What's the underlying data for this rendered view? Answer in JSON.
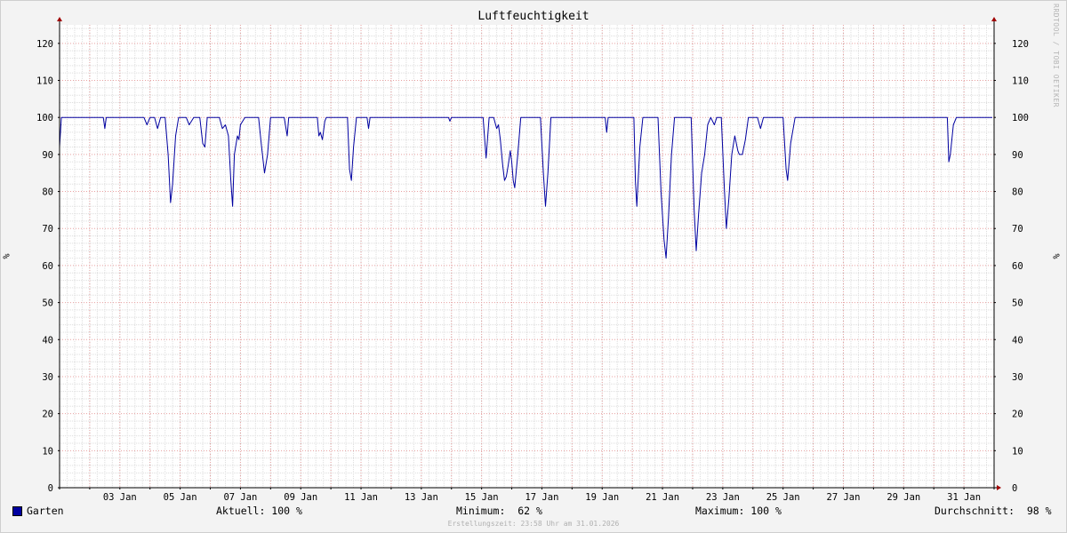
{
  "window": {
    "title": "Luftfeuchtigkeit",
    "credit": "RRDTOOL / TOBI OETIKER",
    "footer": "Erstellungszeit: 23:58 Uhr am 31.01.2026"
  },
  "colors": {
    "background": "#f3f3f3",
    "canvas": "#ffffff",
    "major_grid": "#e8a0a0",
    "minor_grid": "#dddddd",
    "axis": "#000000",
    "arrow": "#a00000",
    "series": "#0000a0"
  },
  "legend": {
    "series_name": "Garten",
    "current": "Aktuell: 100 %",
    "minimum": "Minimum:  62 %",
    "maximum": "Maximum: 100 %",
    "average": "Durchschnitt:  98 %"
  },
  "chart_data": {
    "type": "line",
    "title": "Luftfeuchtigkeit",
    "ylabel": "%",
    "ylim": [
      0,
      125
    ],
    "yticks": [
      0,
      10,
      20,
      30,
      40,
      50,
      60,
      70,
      80,
      90,
      100,
      110,
      120
    ],
    "xlim_days": [
      1,
      32
    ],
    "xticks": [
      {
        "day": 3,
        "label": "03 Jan"
      },
      {
        "day": 5,
        "label": "05 Jan"
      },
      {
        "day": 7,
        "label": "07 Jan"
      },
      {
        "day": 9,
        "label": "09 Jan"
      },
      {
        "day": 11,
        "label": "11 Jan"
      },
      {
        "day": 13,
        "label": "13 Jan"
      },
      {
        "day": 15,
        "label": "15 Jan"
      },
      {
        "day": 17,
        "label": "17 Jan"
      },
      {
        "day": 19,
        "label": "19 Jan"
      },
      {
        "day": 21,
        "label": "21 Jan"
      },
      {
        "day": 23,
        "label": "23 Jan"
      },
      {
        "day": 25,
        "label": "25 Jan"
      },
      {
        "day": 27,
        "label": "27 Jan"
      },
      {
        "day": 29,
        "label": "29 Jan"
      },
      {
        "day": 31,
        "label": "31 Jan"
      }
    ],
    "grid": true,
    "legend_position": "bottom",
    "series": [
      {
        "name": "Garten",
        "color": "#0000a0",
        "points": [
          [
            1.0,
            92
          ],
          [
            1.06,
            100
          ],
          [
            2.45,
            100
          ],
          [
            2.5,
            97
          ],
          [
            2.55,
            100
          ],
          [
            3.8,
            100
          ],
          [
            3.9,
            98
          ],
          [
            4.0,
            100
          ],
          [
            4.15,
            100
          ],
          [
            4.25,
            97
          ],
          [
            4.35,
            100
          ],
          [
            4.5,
            100
          ],
          [
            4.6,
            90
          ],
          [
            4.68,
            77
          ],
          [
            4.75,
            82
          ],
          [
            4.85,
            95
          ],
          [
            4.95,
            100
          ],
          [
            5.2,
            100
          ],
          [
            5.3,
            98
          ],
          [
            5.45,
            100
          ],
          [
            5.65,
            100
          ],
          [
            5.75,
            93
          ],
          [
            5.82,
            92
          ],
          [
            5.9,
            100
          ],
          [
            6.3,
            100
          ],
          [
            6.4,
            97
          ],
          [
            6.5,
            98
          ],
          [
            6.6,
            95
          ],
          [
            6.68,
            83
          ],
          [
            6.74,
            76
          ],
          [
            6.8,
            90
          ],
          [
            6.9,
            95
          ],
          [
            6.95,
            94
          ],
          [
            7.0,
            98
          ],
          [
            7.15,
            100
          ],
          [
            7.6,
            100
          ],
          [
            7.7,
            92
          ],
          [
            7.8,
            85
          ],
          [
            7.9,
            90
          ],
          [
            8.0,
            100
          ],
          [
            8.45,
            100
          ],
          [
            8.55,
            95
          ],
          [
            8.6,
            100
          ],
          [
            9.55,
            100
          ],
          [
            9.6,
            95
          ],
          [
            9.65,
            96
          ],
          [
            9.72,
            94
          ],
          [
            9.8,
            99
          ],
          [
            9.85,
            100
          ],
          [
            10.55,
            100
          ],
          [
            10.62,
            86
          ],
          [
            10.68,
            83
          ],
          [
            10.75,
            92
          ],
          [
            10.85,
            100
          ],
          [
            11.2,
            100
          ],
          [
            11.25,
            97
          ],
          [
            11.3,
            100
          ],
          [
            13.9,
            100
          ],
          [
            13.95,
            99
          ],
          [
            14.0,
            100
          ],
          [
            15.05,
            100
          ],
          [
            15.15,
            89
          ],
          [
            15.25,
            100
          ],
          [
            15.4,
            100
          ],
          [
            15.5,
            97
          ],
          [
            15.56,
            98
          ],
          [
            15.62,
            94
          ],
          [
            15.7,
            87
          ],
          [
            15.76,
            83
          ],
          [
            15.82,
            84
          ],
          [
            15.88,
            87
          ],
          [
            15.95,
            91
          ],
          [
            16.0,
            88
          ],
          [
            16.05,
            83
          ],
          [
            16.1,
            81
          ],
          [
            16.2,
            90
          ],
          [
            16.3,
            100
          ],
          [
            16.95,
            100
          ],
          [
            17.05,
            85
          ],
          [
            17.12,
            76
          ],
          [
            17.2,
            85
          ],
          [
            17.3,
            100
          ],
          [
            19.1,
            100
          ],
          [
            19.15,
            96
          ],
          [
            19.2,
            100
          ],
          [
            20.05,
            100
          ],
          [
            20.1,
            83
          ],
          [
            20.15,
            76
          ],
          [
            20.25,
            92
          ],
          [
            20.35,
            100
          ],
          [
            20.85,
            100
          ],
          [
            20.95,
            80
          ],
          [
            21.05,
            67
          ],
          [
            21.12,
            62
          ],
          [
            21.2,
            73
          ],
          [
            21.3,
            90
          ],
          [
            21.4,
            100
          ],
          [
            21.95,
            100
          ],
          [
            22.05,
            75
          ],
          [
            22.12,
            64
          ],
          [
            22.2,
            74
          ],
          [
            22.3,
            85
          ],
          [
            22.4,
            90
          ],
          [
            22.5,
            98
          ],
          [
            22.6,
            100
          ],
          [
            22.72,
            98
          ],
          [
            22.8,
            100
          ],
          [
            22.95,
            100
          ],
          [
            23.05,
            81
          ],
          [
            23.12,
            70
          ],
          [
            23.2,
            78
          ],
          [
            23.3,
            90
          ],
          [
            23.4,
            95
          ],
          [
            23.5,
            91
          ],
          [
            23.55,
            90
          ],
          [
            23.65,
            90
          ],
          [
            23.75,
            94
          ],
          [
            23.85,
            100
          ],
          [
            24.15,
            100
          ],
          [
            24.25,
            97
          ],
          [
            24.35,
            100
          ],
          [
            25.0,
            100
          ],
          [
            25.1,
            86
          ],
          [
            25.15,
            83
          ],
          [
            25.25,
            93
          ],
          [
            25.4,
            100
          ],
          [
            25.5,
            100
          ],
          [
            30.45,
            100
          ],
          [
            30.5,
            88
          ],
          [
            30.55,
            90
          ],
          [
            30.65,
            98
          ],
          [
            30.75,
            100
          ],
          [
            31.94,
            100
          ]
        ]
      }
    ]
  }
}
